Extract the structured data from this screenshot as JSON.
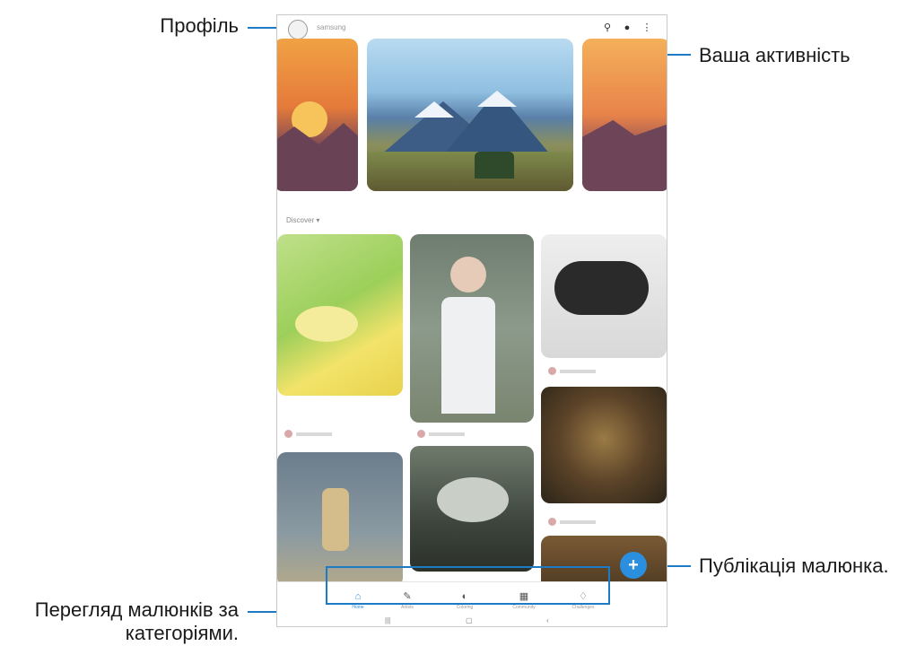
{
  "callouts": {
    "profile": "Профіль",
    "activity": "Ваша активність",
    "publish": "Публікація малюнка.",
    "browse_line1": "Перегляд малюнків за",
    "browse_line2": "категоріями."
  },
  "app": {
    "username": "samsung",
    "filter_label": "Discover",
    "fab_symbol": "+"
  },
  "icons": {
    "search": "search-icon",
    "notifications": "bell-icon",
    "more": "more-options-icon",
    "add": "plus-icon"
  },
  "nav": [
    {
      "label": "Home",
      "icon": "home-icon",
      "active": true
    },
    {
      "label": "Artists",
      "icon": "artists-icon",
      "active": false
    },
    {
      "label": "Coloring",
      "icon": "coloring-icon",
      "active": false
    },
    {
      "label": "Community",
      "icon": "community-icon",
      "active": false
    },
    {
      "label": "Challenges",
      "icon": "challenges-icon",
      "active": false
    }
  ],
  "colors": {
    "accent": "#2b8fe0",
    "callout_line": "#1c7bc4"
  }
}
